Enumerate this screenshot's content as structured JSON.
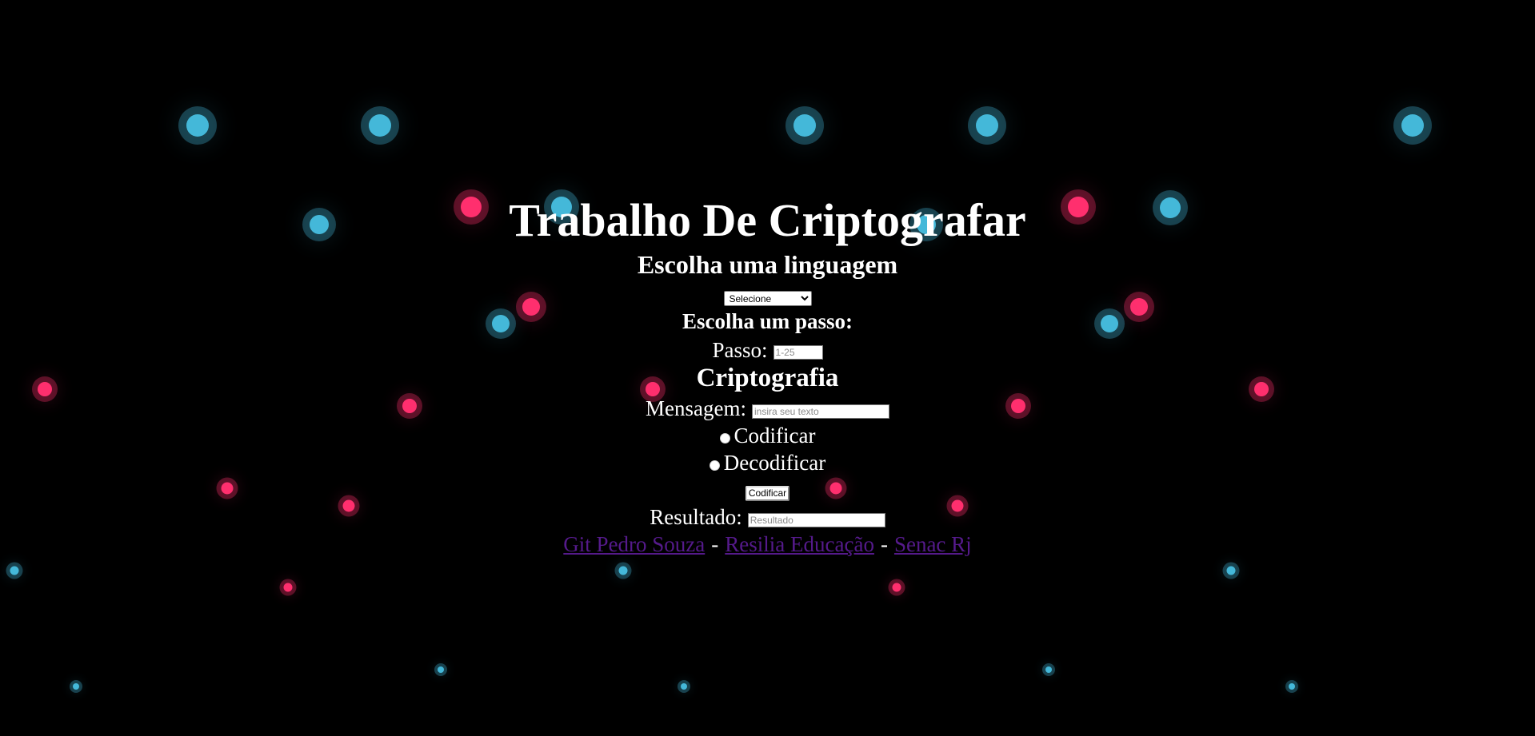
{
  "page": {
    "title": "Trabalho De Criptografar",
    "language_heading": "Escolha uma linguagem",
    "language_select": {
      "selected": "Selecione"
    },
    "step_heading": "Escolha um passo:",
    "step_label": "Passo:",
    "step_placeholder": "1-25",
    "crypto_heading": "Criptografia",
    "message_label": "Mensagem:",
    "message_placeholder": "insira seu texto",
    "radio_encode_label": "Codificar",
    "radio_decode_label": "Decodificar",
    "submit_button_label": "Codificar",
    "result_label": "Resultado:",
    "result_placeholder": "Resultado",
    "footer_links": [
      {
        "label": "Git Pedro Souza"
      },
      {
        "label": "Resilia Educação"
      },
      {
        "label": "Senac Rj"
      }
    ],
    "footer_separator": "-"
  },
  "colors": {
    "background": "#000000",
    "text": "#ffffff",
    "link_visited": "#551a8b",
    "dot_blue": "#44b8d9",
    "dot_pink": "#ff2f6e"
  }
}
